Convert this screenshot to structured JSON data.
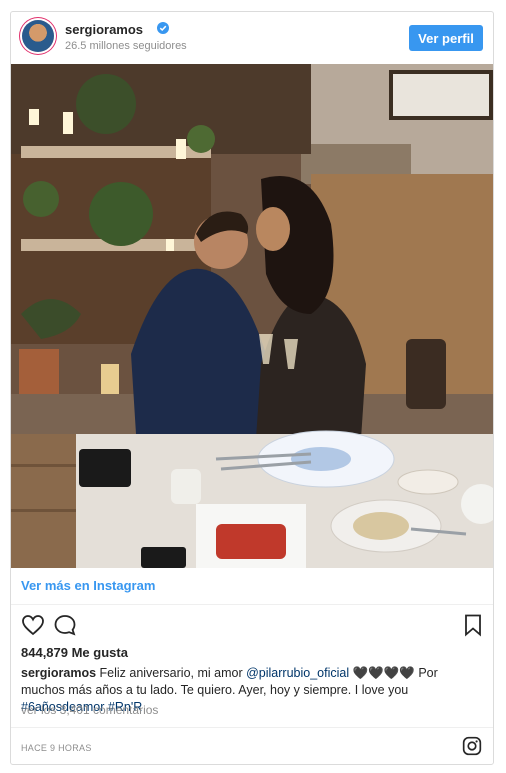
{
  "header": {
    "username": "sergioramos",
    "followers": "26.5 millones seguidores",
    "profile_button": "Ver perfil",
    "verified_icon": "verified-badge-icon",
    "accent": "#3897f0"
  },
  "photo": {
    "alt_icon": "post-photo"
  },
  "footer": {
    "more_link": "Ver más en Instagram",
    "likes": "844,879 Me gusta",
    "caption_user": "sergioramos",
    "caption_text": "Feliz aniversario, mi amor",
    "caption_mention": "@pilarrubio_oficial",
    "caption_hearts": "🖤🖤🖤🖤",
    "caption_rest": "Por muchos más años a tu lado. Te quiero. Ayer, hoy y siempre. I love you",
    "caption_tag1": "#6añosdeamor",
    "caption_tag2": "#Rn'R",
    "comments": "ver los 3,401 comentarios",
    "timestamp": "HACE 9 HORAS"
  },
  "icons": {
    "like": "heart-outline-icon",
    "comment": "comment-bubble-icon",
    "save": "bookmark-icon",
    "brand": "instagram-icon"
  }
}
